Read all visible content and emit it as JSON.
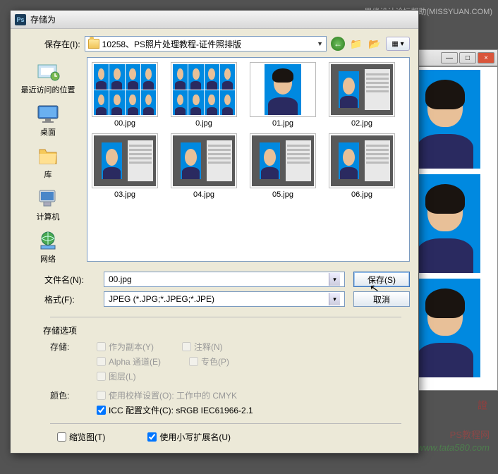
{
  "watermark_top": "思缘设计论坛帮助(MISSYUAN.COM)",
  "watermark_bottom_1": "PS教程网",
  "watermark_bottom_2": "www.tata580.com",
  "dialog": {
    "title": "存储为",
    "save_in_label": "保存在(I):",
    "folder_name": "10258、PS照片处理教程-证件照排版",
    "filename_label": "文件名(N):",
    "filename_value": "00.jpg",
    "format_label": "格式(F):",
    "format_value": "JPEG (*.JPG;*.JPEG;*.JPE)",
    "save_btn": "保存(S)",
    "cancel_btn": "取消"
  },
  "sidebar": {
    "items": [
      {
        "label": "最近访问的位置"
      },
      {
        "label": "桌面"
      },
      {
        "label": "库"
      },
      {
        "label": "计算机"
      },
      {
        "label": "网络"
      }
    ]
  },
  "files": [
    {
      "name": "00.jpg",
      "type": "grid"
    },
    {
      "name": "0.jpg",
      "type": "grid"
    },
    {
      "name": "01.jpg",
      "type": "single"
    },
    {
      "name": "02.jpg",
      "type": "psshot"
    },
    {
      "name": "03.jpg",
      "type": "psshot"
    },
    {
      "name": "04.jpg",
      "type": "psshot"
    },
    {
      "name": "05.jpg",
      "type": "psshot"
    },
    {
      "name": "06.jpg",
      "type": "psshot"
    }
  ],
  "options": {
    "section_label": "存储选项",
    "save_label": "存储:",
    "as_copy": "作为副本(Y)",
    "annotations": "注释(N)",
    "alpha": "Alpha 通道(E)",
    "spot": "专色(P)",
    "layers": "图层(L)",
    "color_label": "颜色:",
    "proof": "使用校样设置(O): 工作中的 CMYK",
    "icc": "ICC 配置文件(C): sRGB IEC61966-2.1",
    "thumbnail": "缩览图(T)",
    "lowercase_ext": "使用小写扩展名(U)"
  }
}
